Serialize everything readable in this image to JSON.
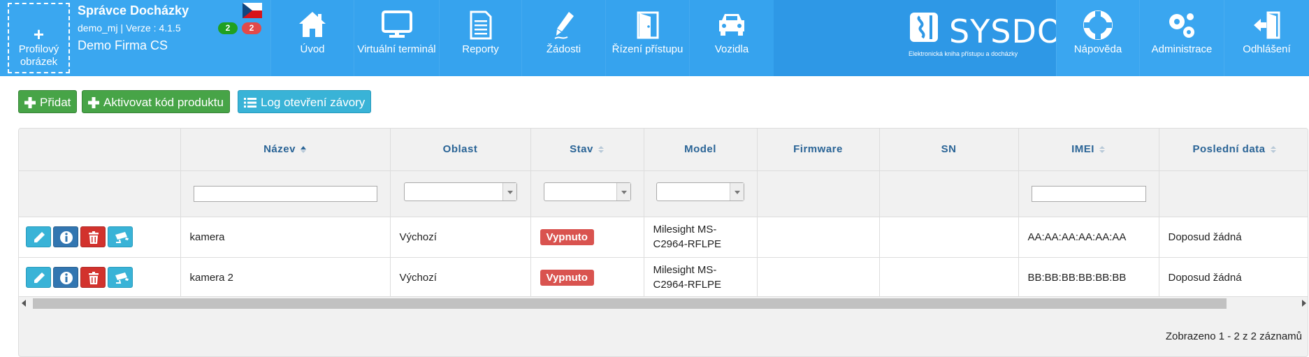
{
  "user": {
    "avatar_plus": "+",
    "avatar_label": "Profilový obrázek",
    "name": "Správce Docházky",
    "version_line": "demo_mj | Verze : 4.1.5",
    "company": "Demo Firma CS",
    "badge_green": "2",
    "badge_red": "2",
    "language_flag": "cz-flag-icon"
  },
  "nav": {
    "home": "Úvod",
    "terminal": "Virtuální terminál",
    "reports": "Reporty",
    "requests": "Žádosti",
    "access": "Řízení přístupu",
    "vehicles": "Vozidla",
    "help": "Nápověda",
    "admin": "Administrace",
    "logout": "Odhlášení"
  },
  "brand": {
    "name": "SYSDO",
    "tagline": "Elektronická kniha přístupu a docházky"
  },
  "toolbar": {
    "add": "Přidat",
    "activate": "Aktivovat kód produktu",
    "log": "Log otevření závory"
  },
  "table": {
    "columns": [
      "",
      "Název",
      "Oblast",
      "Stav",
      "Model",
      "Firmware",
      "SN",
      "IMEI",
      "Poslední data"
    ],
    "rows": [
      {
        "name": "kamera",
        "area": "Výchozí",
        "status": "Vypnuto",
        "model_l1": "Milesight MS-",
        "model_l2": "C2964-RFLPE",
        "firmware": "",
        "sn": "",
        "imei": "AA:AA:AA:AA:AA:AA",
        "last": "Doposud žádná"
      },
      {
        "name": "kamera 2",
        "area": "Výchozí",
        "status": "Vypnuto",
        "model_l1": "Milesight MS-",
        "model_l2": "C2964-RFLPE",
        "firmware": "",
        "sn": "",
        "imei": "BB:BB:BB:BB:BB:BB",
        "last": "Doposud žádná"
      }
    ],
    "records_info": "Zobrazeno 1 - 2 z 2 záznamů"
  },
  "colors": {
    "topbar": "#2e98e6",
    "green": "#47a447",
    "info": "#39b3d7",
    "danger": "#d9534f",
    "header_text": "#2a6496"
  }
}
